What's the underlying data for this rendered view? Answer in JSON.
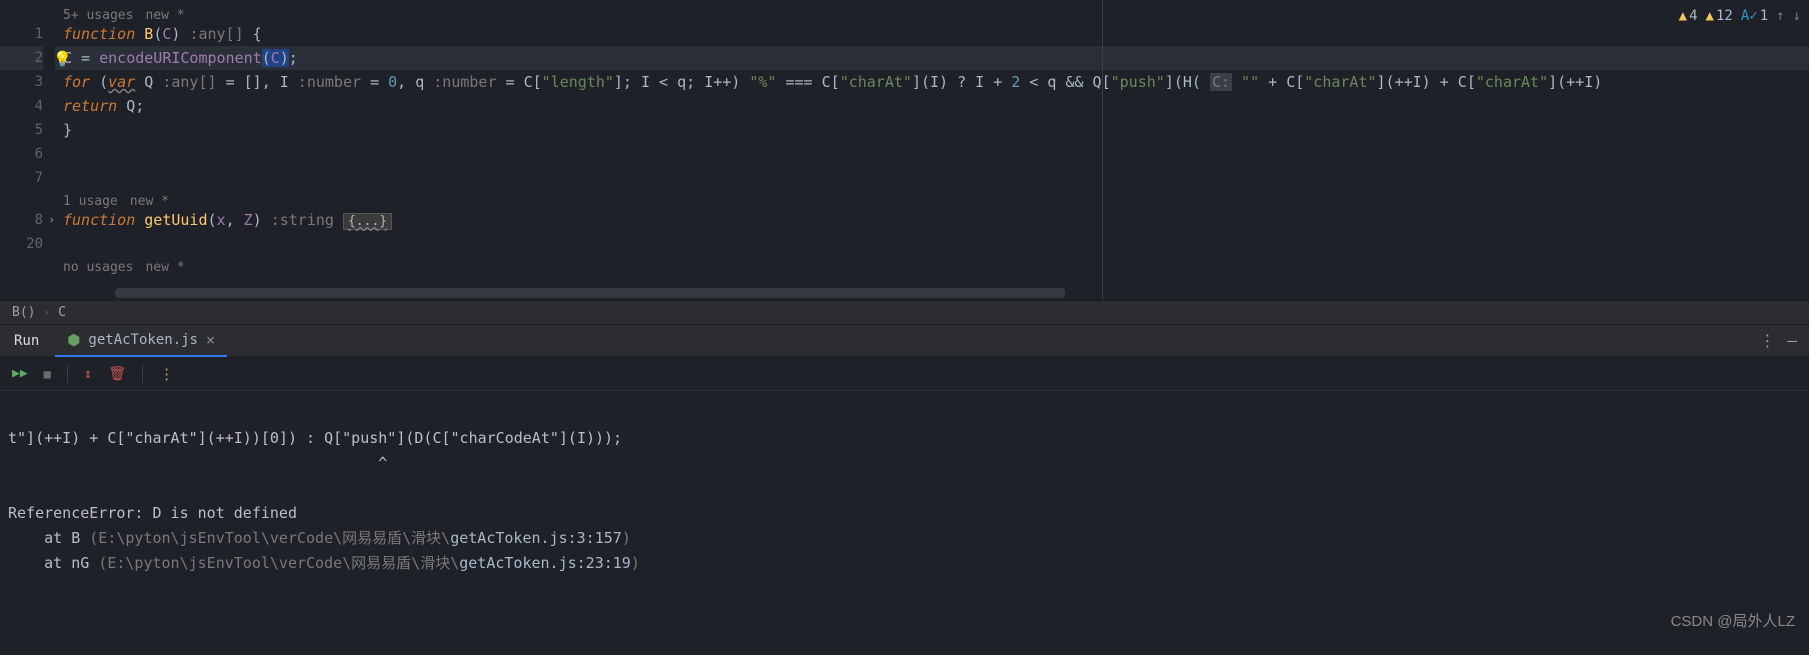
{
  "editor": {
    "line_numbers": [
      "1",
      "2",
      "3",
      "4",
      "5",
      "6",
      "7",
      "8",
      "20",
      ""
    ],
    "hints": {
      "usages5": "5+ usages",
      "new": "new *",
      "usage1": "1 usage",
      "no_usages": "no usages"
    },
    "l1": {
      "kw": "function",
      "fn": "B",
      "lp": "(",
      "p": "C",
      "rp": ")",
      "tp": " :any[]  ",
      "ob": "{"
    },
    "l2": {
      "indent": "    ",
      "v": "C",
      "eq": " = ",
      "fn": "encodeURIComponent",
      "lp": "(",
      "arg": "C",
      "rp": ")",
      "sc": ";"
    },
    "l3": {
      "indent": "    ",
      "for": "for",
      "lp": " (",
      "var": "var",
      "q": " Q",
      "tq": " :any[]  ",
      "eqarr": "= []",
      "c1": ", ",
      "I": "I",
      "ti": " :number  ",
      "eq0": "= ",
      "zero": "0",
      "c2": ", ",
      "qv": "q",
      "tq2": " :number  ",
      "eqC": "= C[",
      "slen": "\"length\"",
      "br": "]; ",
      "cond": "I < q; I++) ",
      "spct": "\"%\"",
      "eqeq": " === C[",
      "schar": "\"charAt\"",
      "call1": "](I) ? I + ",
      "two": "2",
      "lt": " < q && Q[",
      "spush": "\"push\"",
      "callH": "](H( ",
      "Cp": "C:",
      "sdq": " \"\"",
      "plus1": " + C[",
      "schar2": "\"charAt\"",
      "inc1": "](++I) + C[",
      "schar3": "\"charAt\"",
      "inc2": "](++I)"
    },
    "l4": {
      "indent": "    ",
      "ret": "return",
      "sp": " ",
      "Q": "Q",
      "sc": ";"
    },
    "l5": {
      "cb": "}"
    },
    "l8": {
      "kw": "function",
      "fn": "getUuid",
      "lp": "(",
      "p1": "x",
      "c": ", ",
      "p2": "Z",
      "rp": ")",
      "tp": " :string  ",
      "fold": "{...}"
    }
  },
  "inspections": {
    "err": {
      "icon": "▲",
      "count": "4"
    },
    "warn": {
      "icon": "▲",
      "count": "12"
    },
    "typo": {
      "icon": "A✓",
      "count": "1"
    },
    "up": "↑",
    "down": "↓"
  },
  "breadcrumb": {
    "a": "B()",
    "sep": "›",
    "b": "C"
  },
  "tool": {
    "run": "Run",
    "file": "getAcToken.js",
    "close": "×",
    "more": "⋮",
    "min": "—"
  },
  "toolbar": {
    "rerun": "▶▶",
    "stop": "■",
    "filter": "↕",
    "trash": "🗑",
    "more": "⋮"
  },
  "console": {
    "l1": "t\"](++I) + C[\"charAt\"](++I))[0]) : Q[\"push\"](D(C[\"charCodeAt\"](I)));",
    "l2": "                                         ^",
    "l3": "",
    "l4": "ReferenceError: D is not defined",
    "l5a": "    at B ",
    "l5p": "(E:\\pyton\\jsEnvTool\\verCode\\网易易盾\\滑块\\",
    "l5f": "getAcToken.js:3:157",
    "l5e": ")",
    "l6a": "    at nG ",
    "l6p": "(E:\\pyton\\jsEnvTool\\verCode\\网易易盾\\滑块\\",
    "l6f": "getAcToken.js:23:19",
    "l6e": ")"
  },
  "watermark": "CSDN @局外人LZ"
}
